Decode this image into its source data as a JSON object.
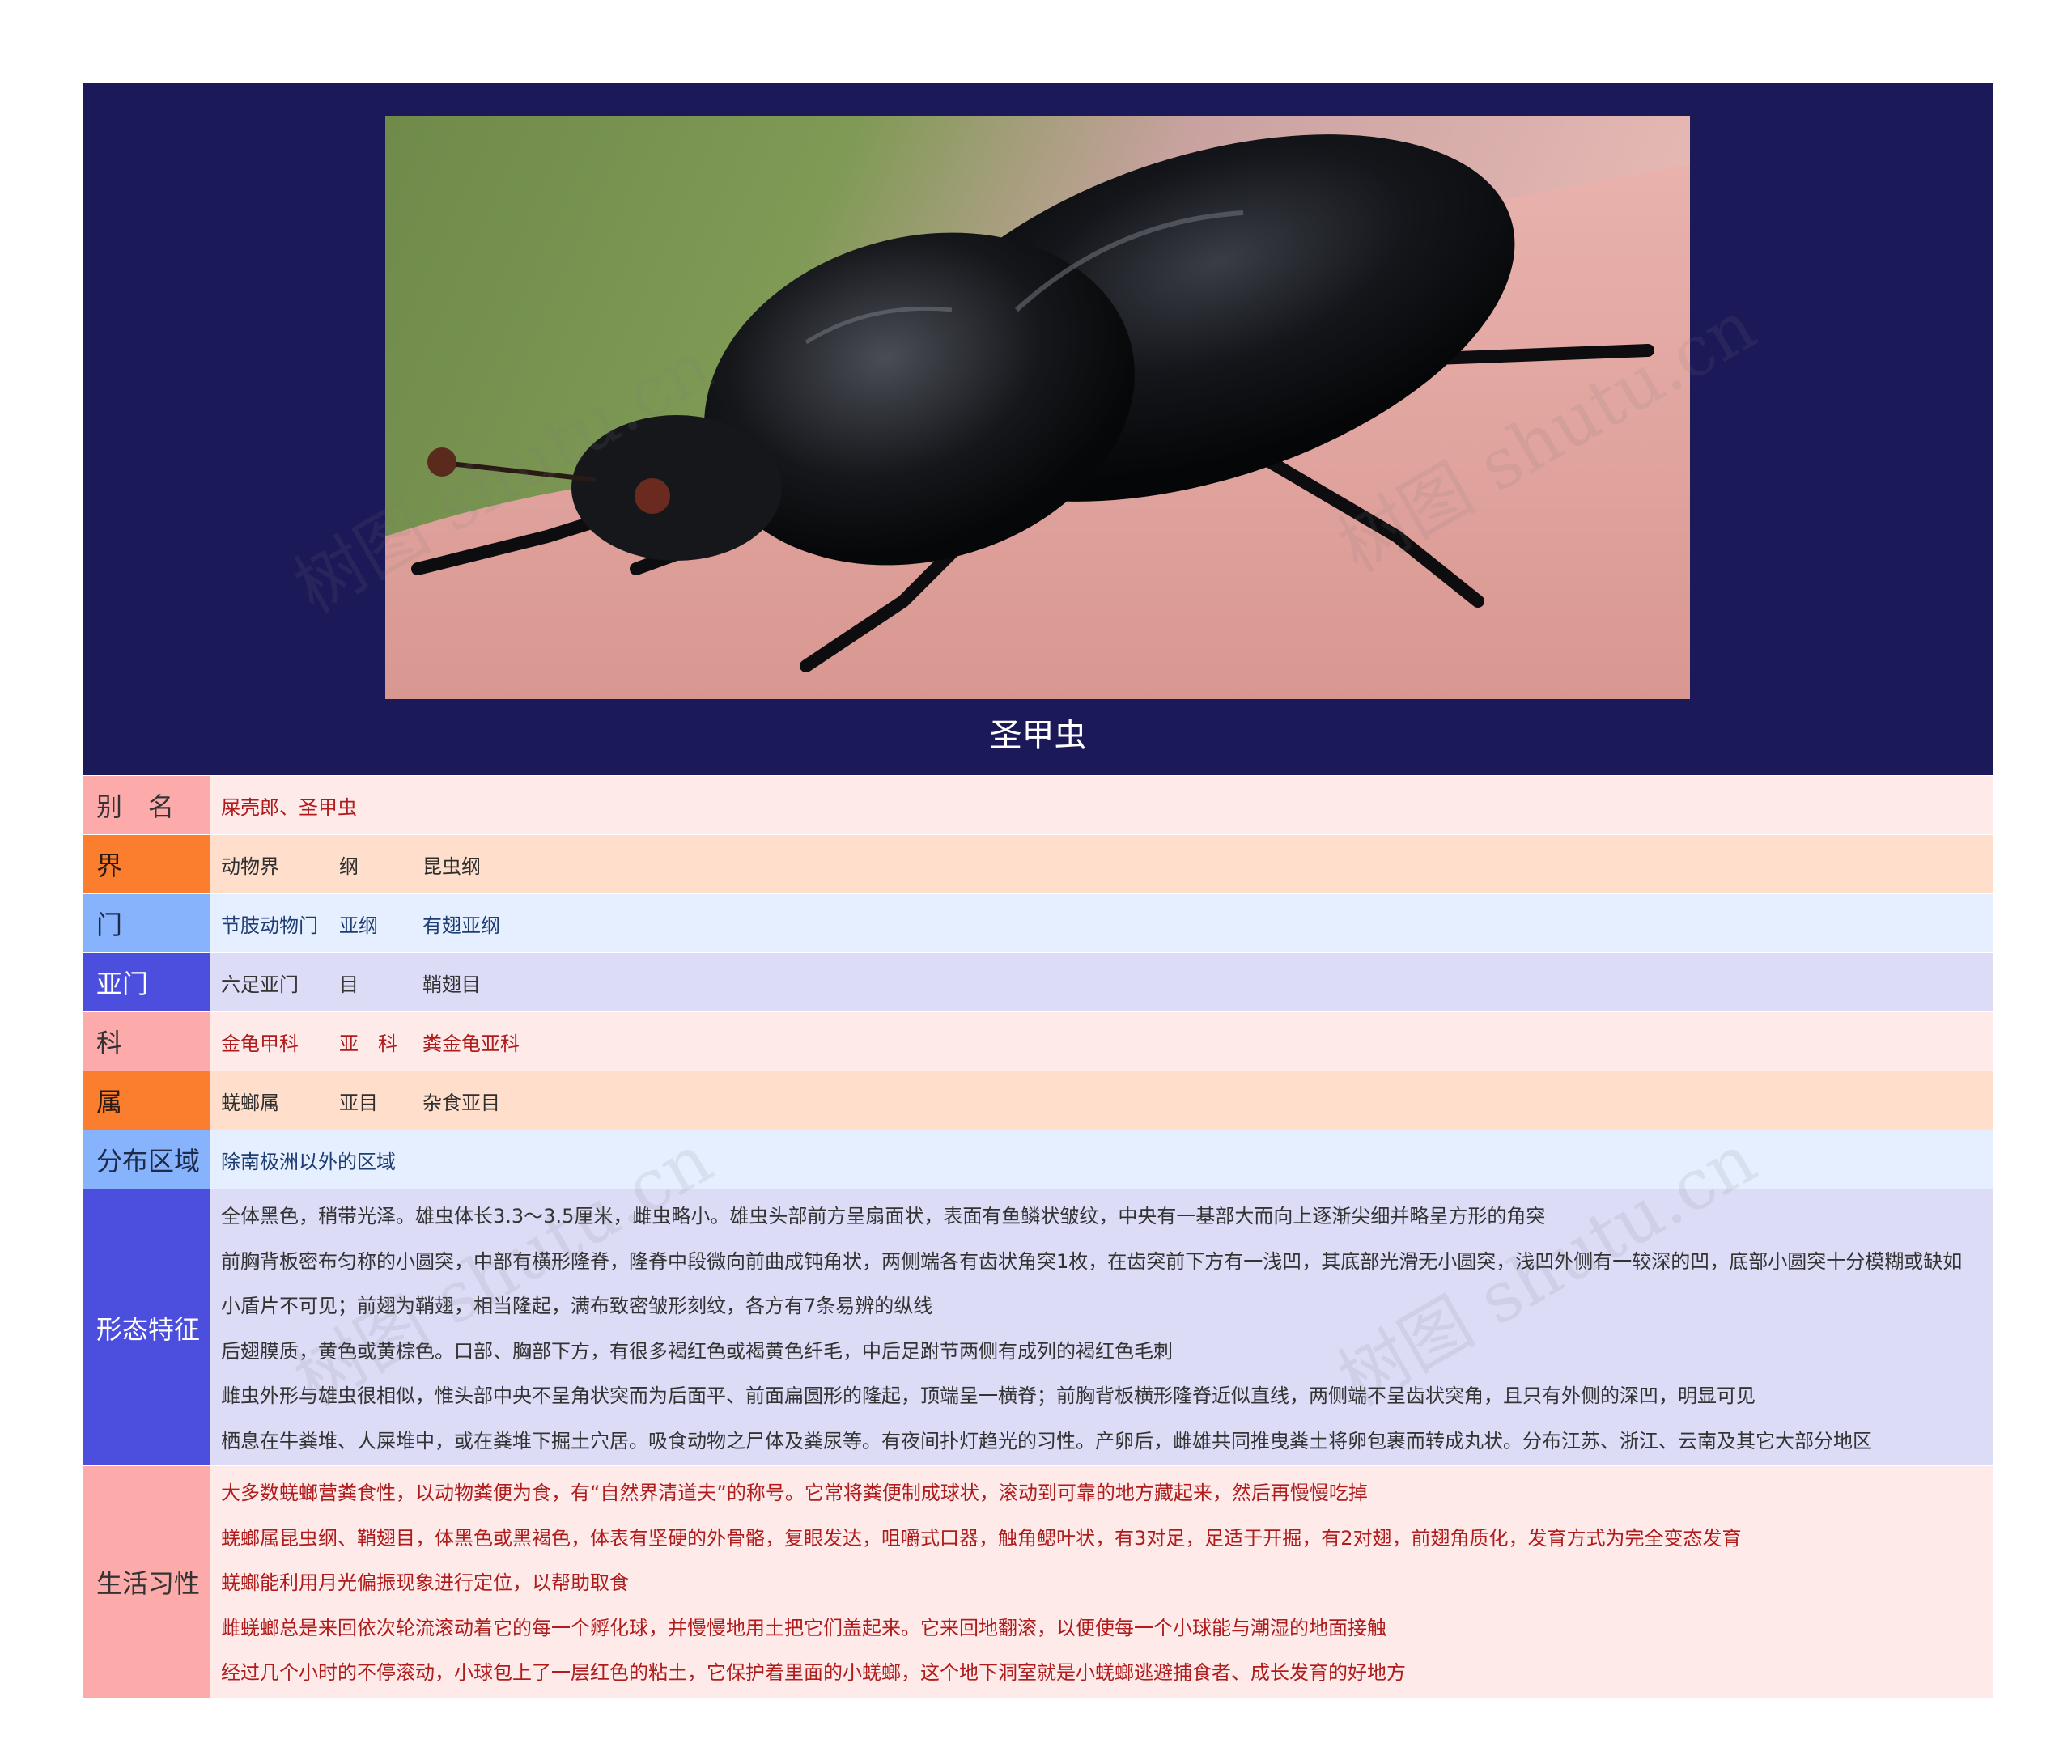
{
  "title": "圣甲虫",
  "image": {
    "subject": "dung-beetle-photo"
  },
  "watermark": "树图 shutu.cn",
  "rows": [
    {
      "label": "别　名",
      "cells": [
        "屎壳郎、圣甲虫"
      ]
    },
    {
      "label": "界",
      "cells": [
        "动物界",
        "纲",
        "昆虫纲"
      ]
    },
    {
      "label": "门",
      "cells": [
        "节肢动物门",
        "亚纲",
        "有翅亚纲"
      ]
    },
    {
      "label": "亚门",
      "cells": [
        "六足亚门",
        "目",
        "鞘翅目"
      ]
    },
    {
      "label": "科",
      "cells": [
        "金龟甲科",
        "亚　科",
        "粪金龟亚科"
      ]
    },
    {
      "label": "属",
      "cells": [
        "蜣螂属",
        "亚目",
        "杂食亚目"
      ]
    },
    {
      "label": "分布区域",
      "cells": [
        "除南极洲以外的区域"
      ]
    }
  ],
  "morphology": {
    "label": "形态特征",
    "paragraphs": [
      "全体黑色，稍带光泽。雄虫体长3.3～3.5厘米，雌虫略小。雄虫头部前方呈扇面状，表面有鱼鳞状皱纹，中央有一基部大而向上逐渐尖细并略呈方形的角突",
      "前胸背板密布匀称的小圆突，中部有横形隆脊，隆脊中段微向前曲成钝角状，两侧端各有齿状角突1枚，在齿突前下方有一浅凹，其底部光滑无小圆突，浅凹外侧有一较深的凹，底部小圆突十分模糊或缺如",
      "小盾片不可见；前翅为鞘翅，相当隆起，满布致密皱形刻纹，各方有7条易辨的纵线",
      "后翅膜质，黄色或黄棕色。口部、胸部下方，有很多褐红色或褐黄色纤毛，中后足跗节两侧有成列的褐红色毛刺",
      "雌虫外形与雄虫很相似，惟头部中央不呈角状突而为后面平、前面扁圆形的隆起，顶端呈一横脊；前胸背板横形隆脊近似直线，两侧端不呈齿状突角，且只有外侧的深凹，明显可见",
      "栖息在牛粪堆、人屎堆中，或在粪堆下掘土穴居。吸食动物之尸体及粪尿等。有夜间扑灯趋光的习性。产卵后，雌雄共同推曳粪土将卵包裹而转成丸状。分布江苏、浙江、云南及其它大部分地区"
    ]
  },
  "habits": {
    "label": "生活习性",
    "paragraphs": [
      "大多数蜣螂营粪食性，以动物粪便为食，有“自然界清道夫”的称号。它常将粪便制成球状，滚动到可靠的地方藏起来，然后再慢慢吃掉",
      "蜣螂属昆虫纲、鞘翅目，体黑色或黑褐色，体表有坚硬的外骨骼，复眼发达，咀嚼式口器，触角鳃叶状，有3对足，足适于开掘，有2对翅，前翅角质化，发育方式为完全变态发育",
      "蜣螂能利用月光偏振现象进行定位，以帮助取食",
      "雌蜣螂总是来回依次轮流滚动着它的每一个孵化球，并慢慢地用土把它们盖起来。它来回地翻滚，以便使每一个小球能与潮湿的地面接触",
      "经过几个小时的不停滚动，小球包上了一层红色的粘土，它保护着里面的小蜣螂，这个地下洞室就是小蜣螂逃避捕食者、成长发育的好地方"
    ]
  }
}
